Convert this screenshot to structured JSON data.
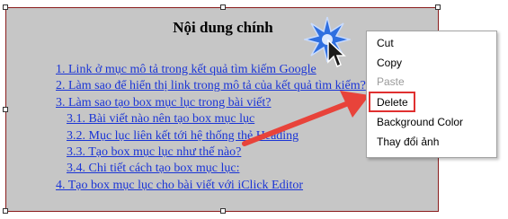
{
  "toc": {
    "title": "Nội dung chính",
    "items": [
      {
        "text": "1. Link ở  mục mô tả trong kết quả tìm kiếm Google",
        "level": 1
      },
      {
        "text": "2. Làm sao để hiển thị link trong mô tả của kết quả tìm kiếm?",
        "level": 1
      },
      {
        "text": "3. Làm sao tạo box mục lục trong bài viết?",
        "level": 1
      },
      {
        "text": "3.1. Bài viết nào nên tạo box mục lục",
        "level": 2
      },
      {
        "text": "3.2. Mục lục liên kết tới hệ thống thẻ Heading",
        "level": 2
      },
      {
        "text": "3.3. Tạo box mục lục như thế nào?",
        "level": 2
      },
      {
        "text": "3.4. Chi tiết cách tạo box mục lục:",
        "level": 2
      },
      {
        "text": "4. Tạo box mục lục cho bài viết với iClick Editor",
        "level": 1
      }
    ]
  },
  "context_menu": {
    "items": [
      {
        "label": "Cut",
        "enabled": true
      },
      {
        "label": "Copy",
        "enabled": true
      },
      {
        "label": "Paste",
        "enabled": false
      },
      {
        "label": "Delete",
        "enabled": true,
        "highlighted": true
      },
      {
        "label": "Background Color",
        "enabled": true
      },
      {
        "label": "Thay đổi ảnh",
        "enabled": true
      }
    ]
  },
  "colors": {
    "box_background": "#c6c6c6",
    "link": "#1a34d6",
    "arrow": "#e8433a",
    "highlight_border": "#e03030",
    "burst": "#2f6fe0"
  },
  "icons": {
    "cursor": "mouse-pointer-icon",
    "burst": "click-burst-icon",
    "arrow": "annotation-arrow"
  }
}
